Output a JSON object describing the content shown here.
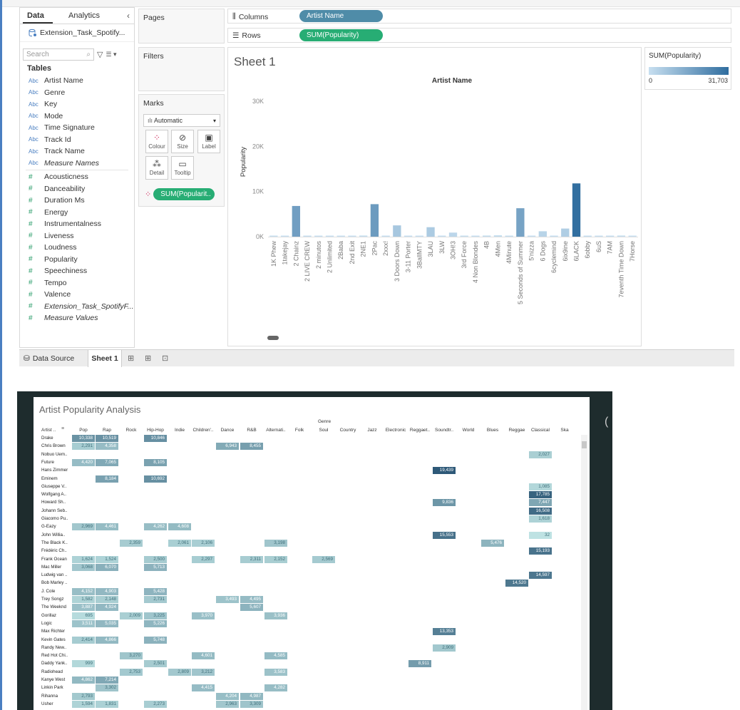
{
  "data_pane": {
    "tabs": [
      "Data",
      "Analytics"
    ],
    "collapse_icon": "chevron-left",
    "datasource": "Extension_Task_Spotify...",
    "search_placeholder": "Search",
    "tables_header": "Tables",
    "dimensions": [
      {
        "label": "Artist Name",
        "italic": false
      },
      {
        "label": "Genre",
        "italic": false
      },
      {
        "label": "Key",
        "italic": false
      },
      {
        "label": "Mode",
        "italic": false
      },
      {
        "label": "Time Signature",
        "italic": false
      },
      {
        "label": "Track Id",
        "italic": false
      },
      {
        "label": "Track Name",
        "italic": false
      },
      {
        "label": "Measure Names",
        "italic": true
      }
    ],
    "measures": [
      {
        "label": "Acousticness",
        "italic": false
      },
      {
        "label": "Danceability",
        "italic": false
      },
      {
        "label": "Duration Ms",
        "italic": false
      },
      {
        "label": "Energy",
        "italic": false
      },
      {
        "label": "Instrumentalness",
        "italic": false
      },
      {
        "label": "Liveness",
        "italic": false
      },
      {
        "label": "Loudness",
        "italic": false
      },
      {
        "label": "Popularity",
        "italic": false
      },
      {
        "label": "Speechiness",
        "italic": false
      },
      {
        "label": "Tempo",
        "italic": false
      },
      {
        "label": "Valence",
        "italic": false
      },
      {
        "label": "Extension_Task_SpotifyF...",
        "italic": true
      },
      {
        "label": "Measure Values",
        "italic": true
      }
    ],
    "dim_icon_text": "Abc",
    "measure_icon_text": "#"
  },
  "cards": {
    "pages": "Pages",
    "filters": "Filters",
    "marks": "Marks",
    "mark_type": "Automatic",
    "mark_buttons": [
      "Colour",
      "Size",
      "Label",
      "Detail",
      "Tooltip"
    ],
    "marks_pill": "SUM(Popularit.."
  },
  "shelves": {
    "columns_label": "Columns",
    "columns_pill": "Artist Name",
    "rows_label": "Rows",
    "rows_pill": "SUM(Popularity)"
  },
  "sheet": {
    "title": "Sheet 1"
  },
  "legend": {
    "title": "SUM(Popularity)",
    "min_label": "0",
    "max_label": "31,703",
    "color_start": "#c7dff0",
    "color_end": "#2f6d9f"
  },
  "chart_data": {
    "type": "bar",
    "title": "Artist Name",
    "xlabel": "",
    "ylabel": "Popularity",
    "ylim": [
      0,
      30000
    ],
    "yticks": [
      "0K",
      "10K",
      "20K",
      "30K"
    ],
    "grid": false,
    "categories": [
      "1K Phew",
      "1takejay",
      "2 Chainz",
      "2 LIVE CREW",
      "2 minutos",
      "2 Unlimited",
      "2Baba",
      "2nd Exit",
      "2NE1",
      "2Pac",
      "2xxx!",
      "3 Doors Down",
      "3-11 Porter",
      "3BallMTY",
      "3LAU",
      "3LW",
      "3OH!3",
      "3rd Force",
      "4 Non Blondes",
      "4B",
      "4Men",
      "4Minute",
      "5 Seconds of Summer",
      "5'nizza",
      "6 Dogs",
      "6cyclemind",
      "6ix9ine",
      "6LACK",
      "6obby",
      "6uS",
      "7AM",
      "7eventh Time Down",
      "7Horse"
    ],
    "values": [
      150,
      20,
      6800,
      180,
      30,
      20,
      20,
      30,
      250,
      7200,
      60,
      2500,
      60,
      30,
      2100,
      60,
      900,
      80,
      60,
      250,
      300,
      150,
      6300,
      60,
      1200,
      60,
      1800,
      11800,
      60,
      30,
      60,
      250,
      30
    ]
  },
  "status_bar": {
    "data_source": "Data Source",
    "sheet_tab": "Sheet 1"
  },
  "heatmap": {
    "title": "Artist Popularity Analysis",
    "column_group_label": "Genre",
    "row_header": "Artist ..",
    "columns": [
      "Pop",
      "Rap",
      "Rock",
      "Hip-Hop",
      "Indie",
      "Children'..",
      "Dance",
      "R&B",
      "Alternati..",
      "Folk",
      "Soul",
      "Country",
      "Jazz",
      "Electronic",
      "Reggaet..",
      "Soundtr..",
      "World",
      "Blues",
      "Reggae",
      "Classical",
      "Ska"
    ],
    "rows": [
      {
        "artist": "Drake",
        "cells": [
          [
            0,
            "10,338"
          ],
          [
            1,
            "10,519"
          ],
          [
            3,
            "10,846"
          ]
        ]
      },
      {
        "artist": "Chris Brown",
        "cells": [
          [
            0,
            "2,291"
          ],
          [
            1,
            "4,358"
          ],
          [
            6,
            "6,943"
          ],
          [
            7,
            "8,455"
          ]
        ]
      },
      {
        "artist": "Nobuo Uem..",
        "cells": [
          [
            19,
            "2,027"
          ]
        ]
      },
      {
        "artist": "Future",
        "cells": [
          [
            0,
            "4,420"
          ],
          [
            1,
            "7,065"
          ],
          [
            3,
            "8,105"
          ]
        ]
      },
      {
        "artist": "Hans Zimmer",
        "cells": [
          [
            15,
            "19,439"
          ]
        ]
      },
      {
        "artist": "Eminem",
        "cells": [
          [
            1,
            "8,184"
          ],
          [
            3,
            "10,692"
          ]
        ]
      },
      {
        "artist": "Giuseppe V..",
        "cells": [
          [
            19,
            "1,085"
          ]
        ]
      },
      {
        "artist": "Wolfgang A..",
        "cells": [
          [
            19,
            "17,785"
          ]
        ]
      },
      {
        "artist": "Howard Sh..",
        "cells": [
          [
            15,
            "9,836"
          ],
          [
            19,
            "7,447"
          ]
        ]
      },
      {
        "artist": "Johann Seb..",
        "cells": [
          [
            19,
            "16,508"
          ]
        ]
      },
      {
        "artist": "Giacomo Pu..",
        "cells": [
          [
            19,
            "1,618"
          ]
        ]
      },
      {
        "artist": "G-Eazy",
        "cells": [
          [
            0,
            "2,969"
          ],
          [
            1,
            "4,461"
          ],
          [
            3,
            "4,262"
          ],
          [
            4,
            "4,608"
          ]
        ]
      },
      {
        "artist": "John Willia..",
        "cells": [
          [
            15,
            "15,553"
          ],
          [
            19,
            "32"
          ]
        ]
      },
      {
        "artist": "The Black K..",
        "cells": [
          [
            2,
            "2,359"
          ],
          [
            4,
            "2,061"
          ],
          [
            5,
            "2,106"
          ],
          [
            8,
            "3,198"
          ],
          [
            17,
            "5,476"
          ]
        ]
      },
      {
        "artist": "Frédéric Ch..",
        "cells": [
          [
            19,
            "15,193"
          ]
        ]
      },
      {
        "artist": "Frank Ocean",
        "cells": [
          [
            0,
            "1,624"
          ],
          [
            1,
            "1,524"
          ],
          [
            3,
            "2,500"
          ],
          [
            5,
            "2,297"
          ],
          [
            7,
            "2,311"
          ],
          [
            8,
            "2,152"
          ],
          [
            10,
            "2,569"
          ]
        ]
      },
      {
        "artist": "Mac Miller",
        "cells": [
          [
            0,
            "3,068"
          ],
          [
            1,
            "6,070"
          ],
          [
            3,
            "5,713"
          ]
        ]
      },
      {
        "artist": "Ludwig van ..",
        "cells": [
          [
            19,
            "14,597"
          ]
        ]
      },
      {
        "artist": "Bob Marley ..",
        "cells": [
          [
            18,
            "14,520"
          ]
        ]
      },
      {
        "artist": "J. Cole",
        "cells": [
          [
            0,
            "4,152"
          ],
          [
            1,
            "4,903"
          ],
          [
            3,
            "5,428"
          ]
        ]
      },
      {
        "artist": "Trey Songz",
        "cells": [
          [
            0,
            "1,582"
          ],
          [
            1,
            "2,148"
          ],
          [
            3,
            "2,731"
          ],
          [
            6,
            "3,493"
          ],
          [
            7,
            "4,495"
          ]
        ]
      },
      {
        "artist": "The Weeknd",
        "cells": [
          [
            0,
            "3,887"
          ],
          [
            1,
            "4,924"
          ],
          [
            7,
            "5,607"
          ]
        ]
      },
      {
        "artist": "Gorillaz",
        "cells": [
          [
            0,
            "695"
          ],
          [
            2,
            "2,009"
          ],
          [
            3,
            "3,225"
          ],
          [
            5,
            "3,970"
          ],
          [
            8,
            "3,936"
          ]
        ]
      },
      {
        "artist": "Logic",
        "cells": [
          [
            0,
            "3,511"
          ],
          [
            1,
            "5,035"
          ],
          [
            3,
            "5,226"
          ]
        ]
      },
      {
        "artist": "Max Richter",
        "cells": [
          [
            15,
            "13,353"
          ]
        ]
      },
      {
        "artist": "Kevin Gates",
        "cells": [
          [
            0,
            "2,414"
          ],
          [
            1,
            "4,866"
          ],
          [
            3,
            "5,748"
          ]
        ]
      },
      {
        "artist": "Randy New..",
        "cells": [
          [
            15,
            "2,909"
          ]
        ]
      },
      {
        "artist": "Red Hot Chi..",
        "cells": [
          [
            2,
            "3,270"
          ],
          [
            5,
            "4,601"
          ],
          [
            8,
            "4,585"
          ]
        ]
      },
      {
        "artist": "Daddy Yank..",
        "cells": [
          [
            0,
            "999"
          ],
          [
            3,
            "2,501"
          ],
          [
            14,
            "8,911"
          ]
        ]
      },
      {
        "artist": "Radiohead",
        "cells": [
          [
            2,
            "2,753"
          ],
          [
            4,
            "2,809"
          ],
          [
            5,
            "3,212"
          ],
          [
            8,
            "3,583"
          ]
        ]
      },
      {
        "artist": "Kanye West",
        "cells": [
          [
            0,
            "4,862"
          ],
          [
            1,
            "7,214"
          ]
        ]
      },
      {
        "artist": "Linkin Park",
        "cells": [
          [
            1,
            "3,302"
          ],
          [
            5,
            "4,415"
          ],
          [
            8,
            "4,282"
          ]
        ]
      },
      {
        "artist": "Rihanna",
        "cells": [
          [
            0,
            "2,793"
          ],
          [
            6,
            "4,204"
          ],
          [
            7,
            "4,987"
          ]
        ]
      },
      {
        "artist": "Usher",
        "cells": [
          [
            0,
            "1,594"
          ],
          [
            1,
            "1,831"
          ],
          [
            3,
            "2,273"
          ],
          [
            6,
            "2,963"
          ],
          [
            7,
            "3,309"
          ]
        ]
      }
    ],
    "color_low": "#bfe3e3",
    "color_high": "#2a5675"
  }
}
